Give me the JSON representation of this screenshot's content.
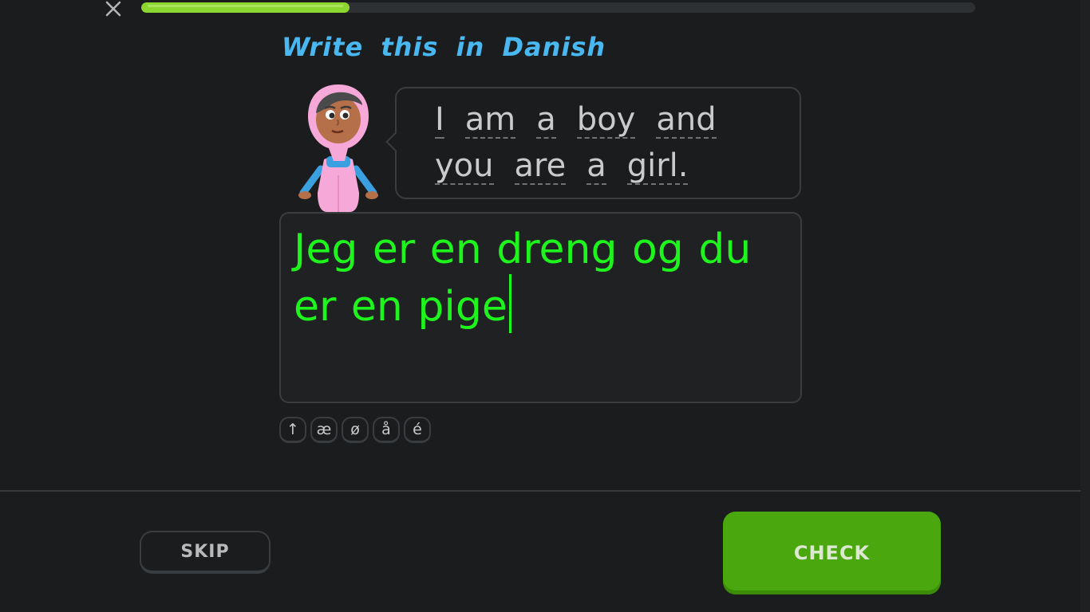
{
  "header": {
    "close_icon": "close-icon",
    "progress": 0.25
  },
  "exercise": {
    "instruction": "Write this in Danish",
    "prompt_words": [
      "I",
      "am",
      "a",
      "boy",
      "and",
      "you",
      "are",
      "a",
      "girl."
    ],
    "answer_value": "Jeg er en dreng og du er en pige"
  },
  "special_chars": [
    {
      "label": "↑",
      "name": "shift-key"
    },
    {
      "label": "æ",
      "name": "char-key-ae"
    },
    {
      "label": "ø",
      "name": "char-key-o-slash"
    },
    {
      "label": "å",
      "name": "char-key-a-ring"
    },
    {
      "label": "é",
      "name": "char-key-e-acute"
    }
  ],
  "footer": {
    "skip_label": "SKIP",
    "check_label": "CHECK"
  },
  "colors": {
    "background": "#1b1c1e",
    "instruction": "#49b7f0",
    "progress": "#8bd72f",
    "answer_text": "#1df51d",
    "check_button": "#4aa70d"
  }
}
